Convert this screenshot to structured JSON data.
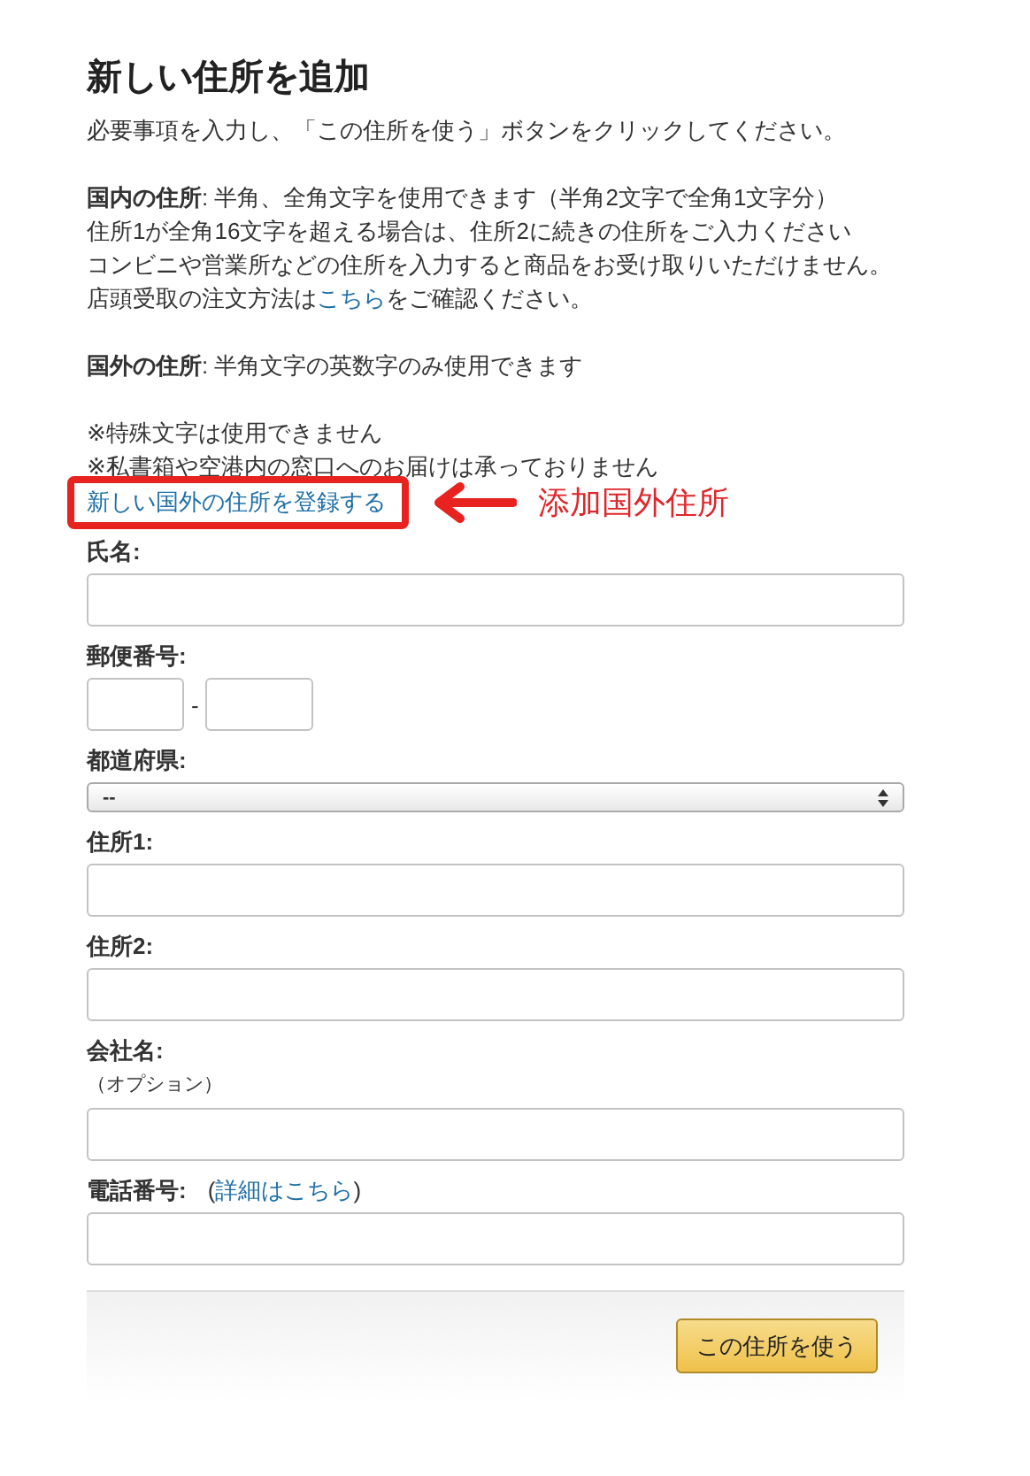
{
  "title": "新しい住所を追加",
  "intro": "必要事項を入力し、「この住所を使う」ボタンをクリックしてください。",
  "domestic_lines": [
    "**国内の住所**: 半角、全角文字を使用できます（半角2文字で全角1文字分）",
    "住所1が全角16文字を超える場合は、住所2に続きの住所をご入力ください",
    "コンビニや営業所などの住所を入力すると商品をお受け取りいただけません。"
  ],
  "pickup_line": {
    "before": "店頭受取の注文方法は",
    "link": "こちら",
    "after": "をご確認ください。"
  },
  "foreign_line": "**国外の住所**: 半角文字の英数字のみ使用できます",
  "notes": [
    "※特殊文字は使用できません",
    "※私書箱や空港内の窓口へのお届けは承っておりません"
  ],
  "foreign_link": "新しい国外の住所を登録する",
  "annotation": {
    "text": "添加国外住所",
    "highlighted": true
  },
  "fields": [
    {
      "kind": "text",
      "label": "氏名:"
    },
    {
      "kind": "postal",
      "label": "郵便番号:",
      "separator": "-"
    },
    {
      "kind": "select",
      "label": "都道府県:",
      "value": "--"
    },
    {
      "kind": "text",
      "label": "住所1:"
    },
    {
      "kind": "text",
      "label": "住所2:"
    },
    {
      "kind": "text",
      "label": "会社名:",
      "sublabel": "（オプション）"
    },
    {
      "kind": "text",
      "label": "電話番号:",
      "help": {
        "open": "(",
        "link": "詳細はこちら",
        "close": ")"
      }
    }
  ],
  "submit_button": "この住所を使う"
}
